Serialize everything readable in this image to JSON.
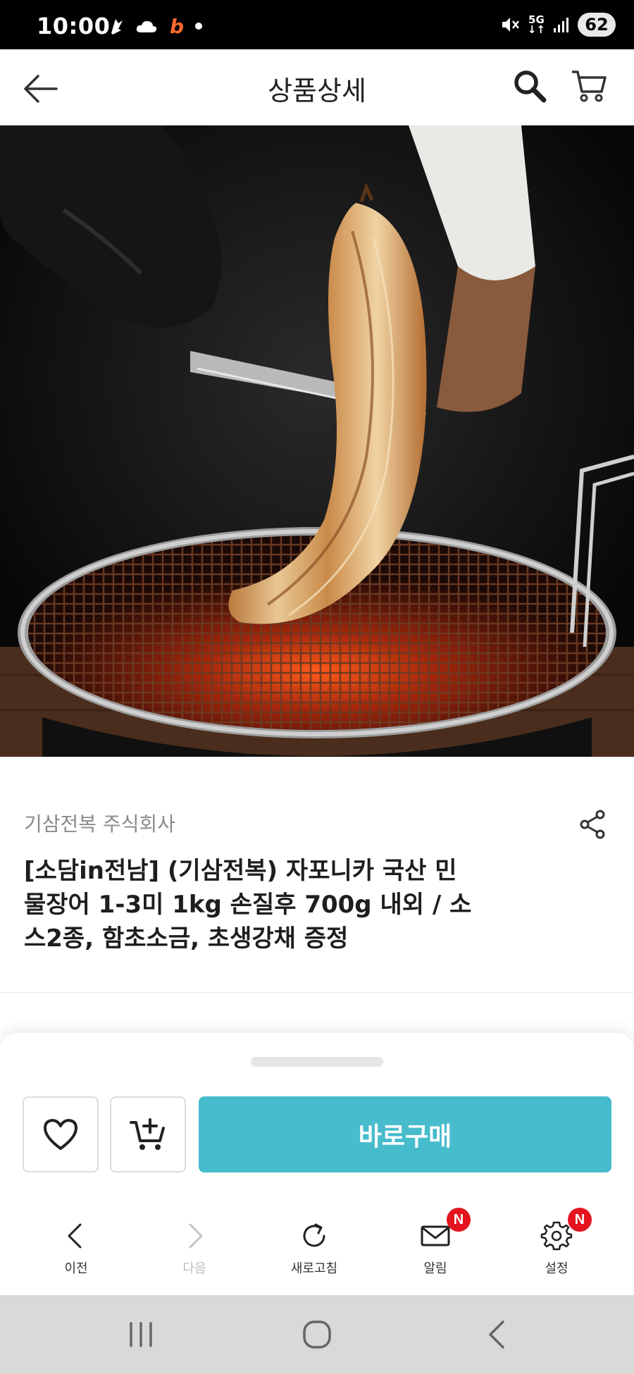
{
  "status_bar": {
    "time": "10:00",
    "network": "5G",
    "battery": "62",
    "left_icons": [
      "app-icon",
      "cloud-icon",
      "b-app-icon",
      "dot-icon"
    ],
    "right_icons": [
      "mute-icon",
      "5g-icon",
      "signal-icon",
      "battery-icon"
    ]
  },
  "header": {
    "title": "상품상세",
    "icons": [
      "back-arrow-icon",
      "search-icon",
      "cart-icon"
    ]
  },
  "product": {
    "image_alt": "grilled eel held with tongs over charcoal grill",
    "seller": "기삼전복 주식회사",
    "title_lines": [
      "[소담in전남] (기삼전복) 자포니카 국산 민",
      "물장어 1-3미 1kg 손질후 700g 내외 / 소",
      "스2종, 함초소금, 초생강채 증정"
    ]
  },
  "purchase": {
    "buy_label": "바로구매",
    "accent_color": "#47bccd"
  },
  "bottom_nav": {
    "items": [
      {
        "label": "이전",
        "icon": "chevron-left-icon",
        "enabled": true
      },
      {
        "label": "다음",
        "icon": "chevron-right-icon",
        "enabled": false
      },
      {
        "label": "새로고침",
        "icon": "refresh-icon",
        "enabled": true
      },
      {
        "label": "알림",
        "icon": "mail-icon",
        "enabled": true,
        "badge": "N"
      },
      {
        "label": "설정",
        "icon": "gear-icon",
        "enabled": true,
        "badge": "N"
      }
    ],
    "badge_color": "#e4141e"
  },
  "system_nav": {
    "icons": [
      "recent-apps-icon",
      "home-icon",
      "back-icon"
    ]
  }
}
